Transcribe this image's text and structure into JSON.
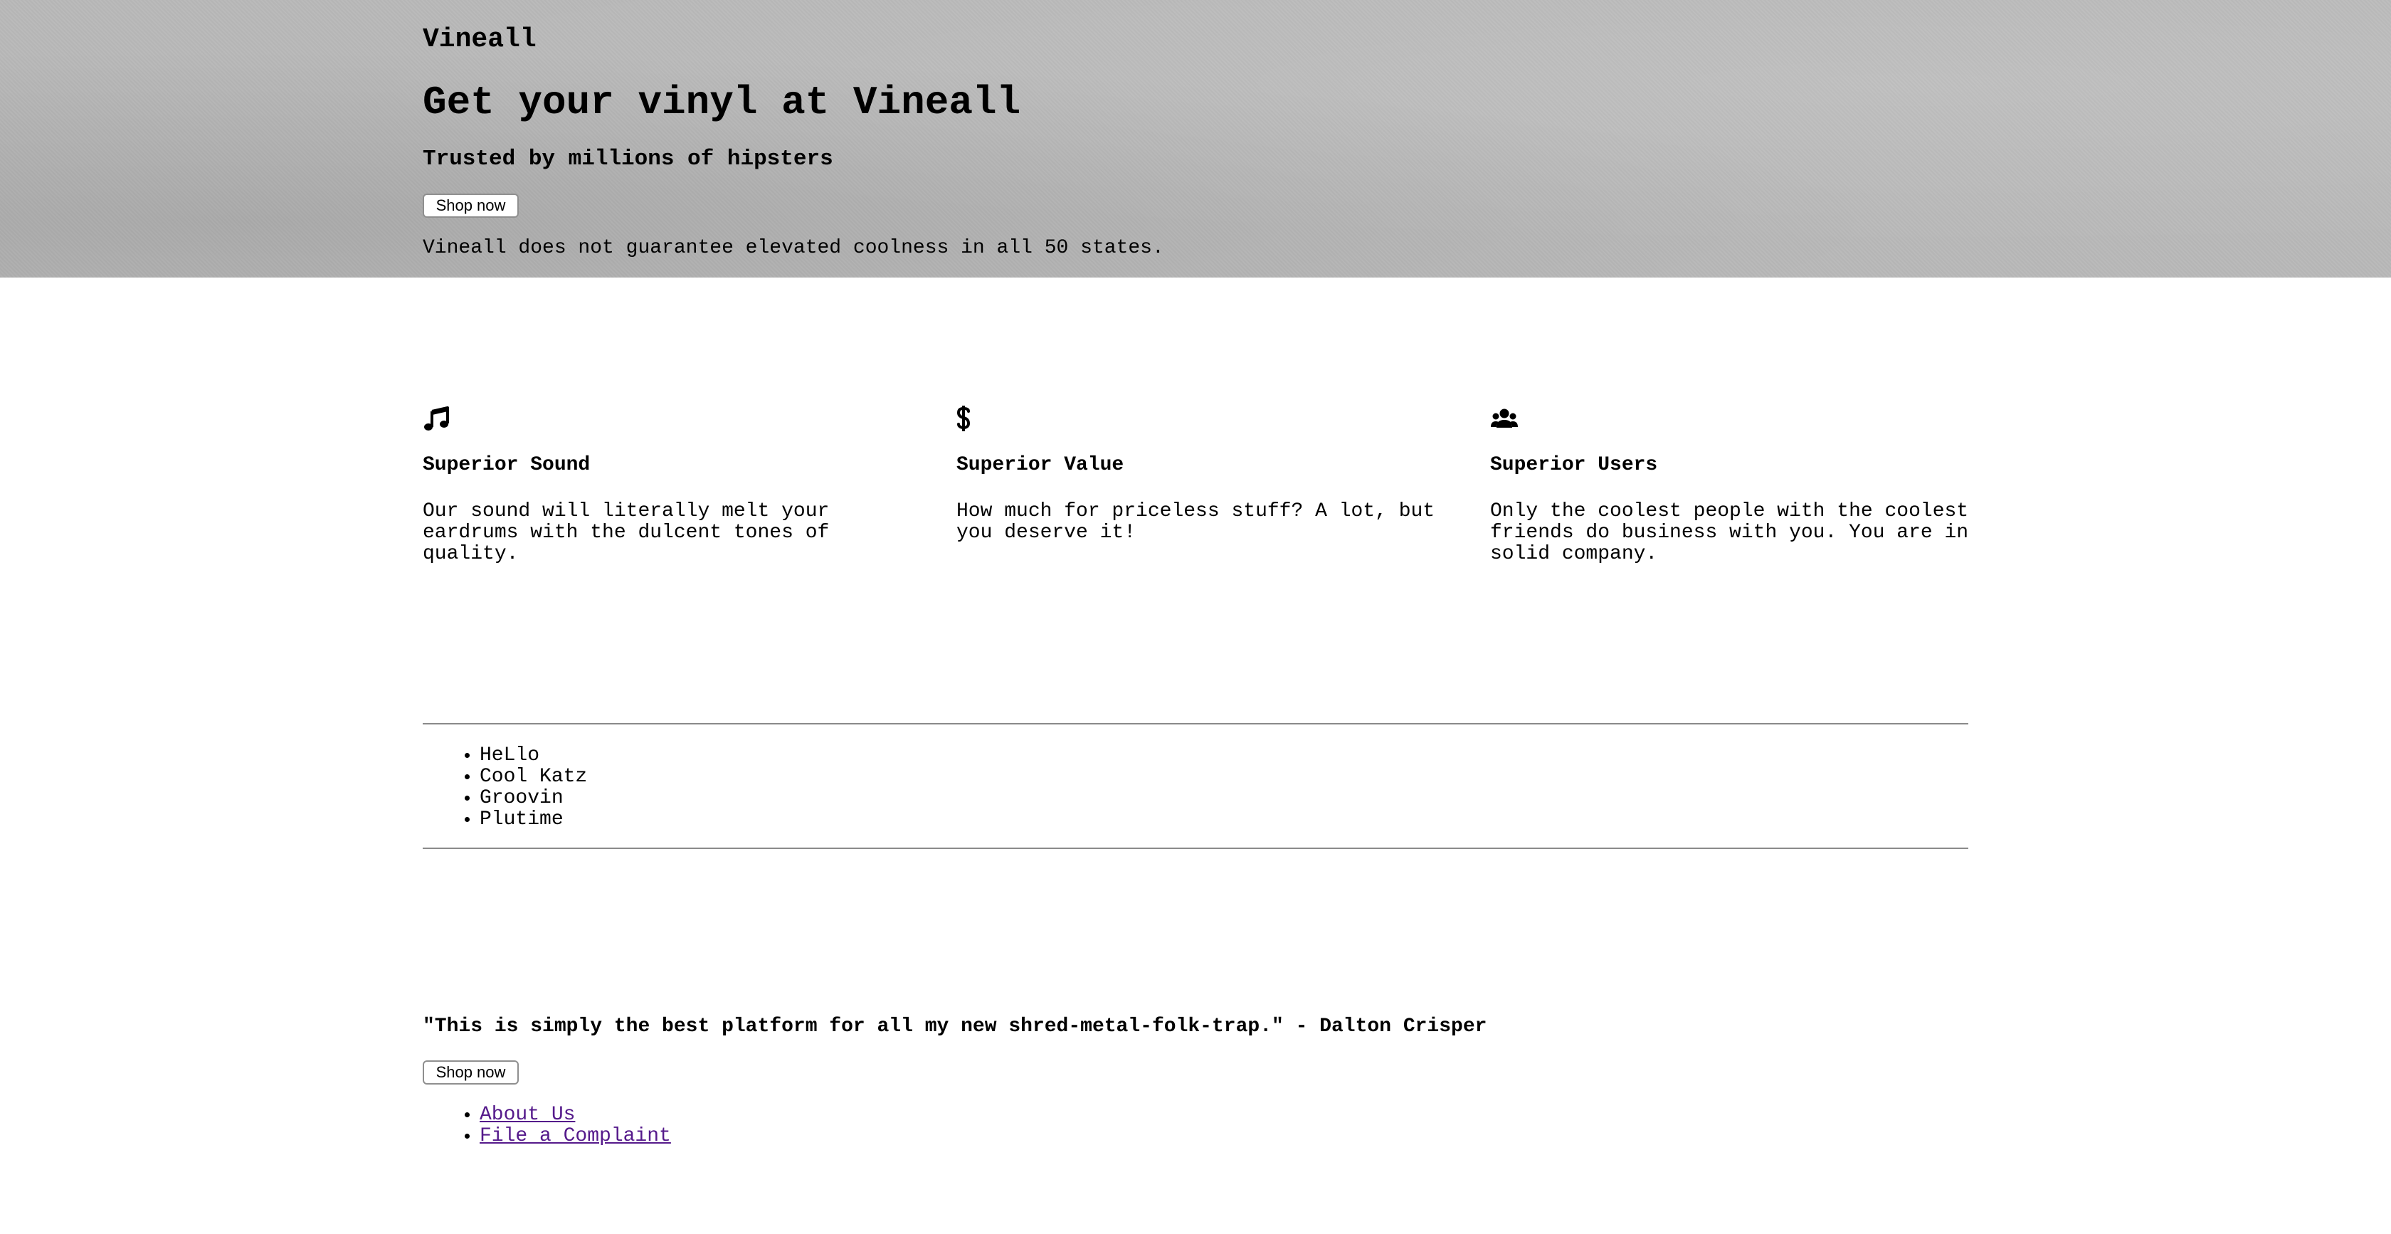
{
  "header": {
    "brand": "Vineall",
    "title": "Get your vinyl at Vineall",
    "subtitle": "Trusted by millions of hipsters",
    "cta_label": "Shop now",
    "disclaimer": "Vineall does not guarantee elevated coolness in all 50 states."
  },
  "features": [
    {
      "icon": "music-note-icon",
      "title": "Superior Sound",
      "text": "Our sound will literally melt your eardrums with the dulcent tones of quality."
    },
    {
      "icon": "dollar-sign-icon",
      "title": "Superior Value",
      "text": "How much for priceless stuff? A lot, but you deserve it!"
    },
    {
      "icon": "users-icon",
      "title": "Superior Users",
      "text": "Only the coolest people with the coolest friends do business with you. You are in solid company."
    }
  ],
  "nav": {
    "items": [
      "HeLlo",
      "Cool Katz",
      "Groovin",
      "Plutime"
    ]
  },
  "testimonial": {
    "quote": "\"This is simply the best platform for all my new shred-metal-folk-trap.\" - Dalton Crisper",
    "cta_label": "Shop now"
  },
  "footer": {
    "links": [
      "About Us",
      "File a Complaint"
    ]
  }
}
